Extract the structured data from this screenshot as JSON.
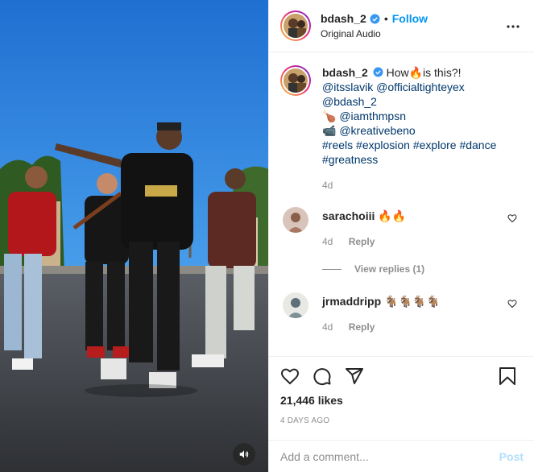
{
  "post": {
    "author": "bdash_2",
    "follow_label": "Follow",
    "dot": "•",
    "audio": "Original Audio",
    "more_icon": "more-horizontal-icon"
  },
  "caption": {
    "author": "bdash_2",
    "text_prefix": "How",
    "emoji_fire": "🔥",
    "text_suffix": "is this?!",
    "mention_1": "@itsslavik",
    "mention_2": "@officialtighteyex",
    "mention_3": "@bdash_2",
    "emoji_drum": "🍗",
    "mention_4": "@iamthmpsn",
    "emoji_camera": "📹",
    "mention_5": "@kreativebeno",
    "hashtag_1": "#reels",
    "hashtag_2": "#explosion",
    "hashtag_3": "#explore",
    "hashtag_4": "#dance",
    "hashtag_5": "#greatness",
    "time": "4d"
  },
  "comments": [
    {
      "user": "sarachoiii",
      "text": "🔥🔥",
      "time": "4d",
      "reply_label": "Reply",
      "view_replies": "View replies (1)"
    },
    {
      "user": "jrmaddripp",
      "text": "🐐🐐🐐🐐",
      "time": "4d",
      "reply_label": "Reply"
    }
  ],
  "actions": {
    "likes": "21,446 likes",
    "posted": "4 days ago",
    "icons": [
      "heart-icon",
      "comment-icon",
      "share-icon",
      "bookmark-icon"
    ]
  },
  "composer": {
    "placeholder": "Add a comment...",
    "post_label": "Post"
  },
  "colors": {
    "accent": "#0095f6",
    "link": "#00376b",
    "muted": "#8e8e8e",
    "post_disabled": "#b2dffc"
  }
}
